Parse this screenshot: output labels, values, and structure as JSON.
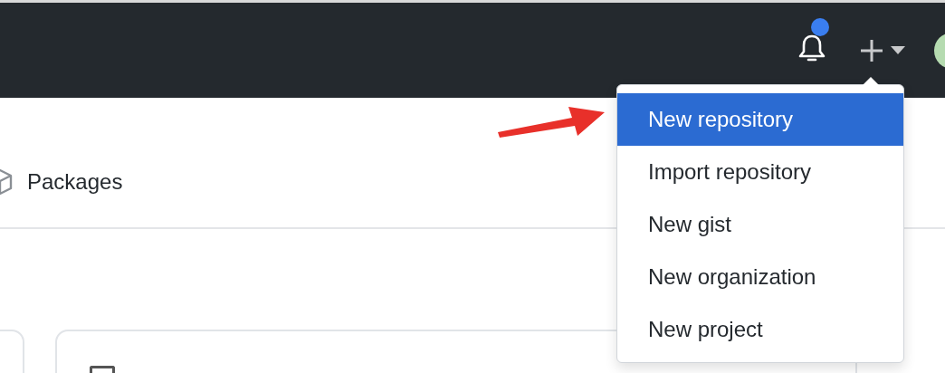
{
  "header": {
    "notifications": {
      "unread": true
    }
  },
  "tabs": [
    {
      "label": "Packages"
    }
  ],
  "create_menu": {
    "items": [
      {
        "label": "New repository",
        "selected": true
      },
      {
        "label": "Import repository",
        "selected": false
      },
      {
        "label": "New gist",
        "selected": false
      },
      {
        "label": "New organization",
        "selected": false
      },
      {
        "label": "New project",
        "selected": false
      }
    ]
  }
}
